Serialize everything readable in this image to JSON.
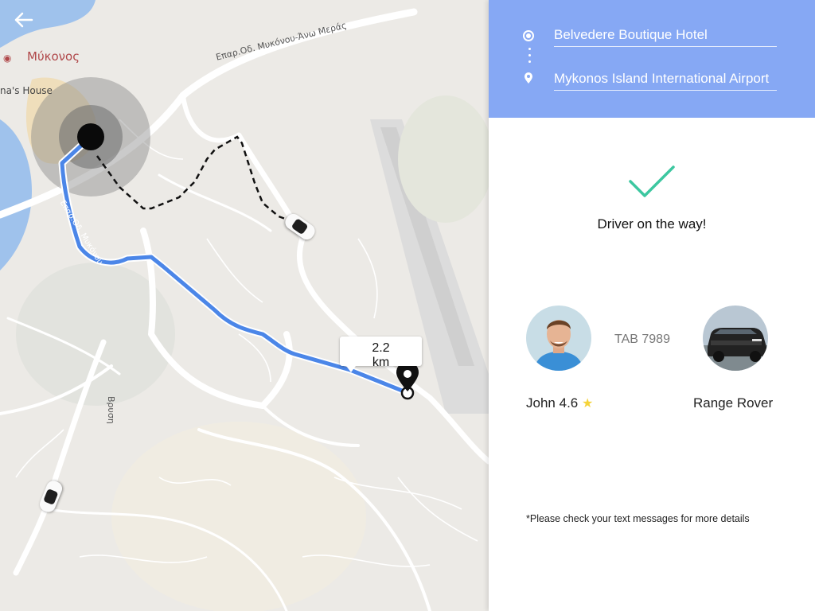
{
  "map": {
    "town_label": "Μύκονος",
    "road_label_top": "Επαρ.Οδ. Μυκόνου-Άνω Μεράς",
    "road_label_left": "Επαρ.Οδ. Μυκόνου",
    "place_label": "na's House",
    "village_label": "Βρυση",
    "distance_value": "2.2",
    "distance_unit": "km"
  },
  "route": {
    "pickup": "Belvedere Boutique Hotel",
    "destination": "Mykonos Island International Airport"
  },
  "status": {
    "message": "Driver on the way!"
  },
  "driver": {
    "name": "John",
    "rating": "4.6",
    "plate": "TAB 7989",
    "car_model": "Range Rover"
  },
  "note": "*Please check your text messages for more details",
  "colors": {
    "header_bg": "#86a8f4",
    "check_green": "#3cc7a0",
    "route_blue": "#4b86e8",
    "star_yellow": "#f5d33a"
  }
}
